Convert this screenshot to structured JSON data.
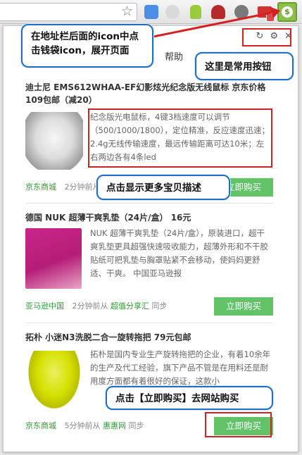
{
  "toolbar": {
    "icons": [
      "star-icon",
      "extension-blue-icon",
      "extension-gray-icon",
      "android-icon",
      "extension-red-icon",
      "extension-gray-round-icon",
      "gmail-icon",
      "wallet-icon"
    ]
  },
  "popup": {
    "help_text": "帮助",
    "tool_icons": [
      "↻",
      "⚙",
      "✕"
    ]
  },
  "callouts": {
    "wallet_hint": "在地址栏后面的icon中点击钱袋icon，展开页面",
    "tools_hint": "这里是常用按钮",
    "desc_hint": "点击显示更多宝贝描述",
    "buy_hint": "点击【立即购买】去网站购买"
  },
  "items": [
    {
      "title": "迪士尼 EMS612WHAA-EF幻影炫光纪念版无线鼠标 京东价格 109包邮（减20）",
      "desc": "纪念版光电鼠标，4键3档速度可以调节（500/1000/1800），定位精准，反应速度迅速；2.4g无线传输速度，最远传输距离可达10米；左右两边各有4条led",
      "source": "京东商城",
      "time": "2分钟前从",
      "buy_label": "立即购买"
    },
    {
      "title": "德国 NUK 超薄干爽乳垫（24片/盒） 16元",
      "desc": "NUK 超薄干爽乳垫（24片/盒），原装进口，超干爽乳垫更具超强快速吸收能力，超薄外形和不干胶贴纸可把乳垫与胸罩贴紧不会移动，使妈妈更舒适、干爽。 中国亚马逊报",
      "source": "亚马逊中国",
      "time": "2分钟前从",
      "from_site": "超值分享汇",
      "sync": "同步",
      "buy_label": "立即购买"
    },
    {
      "title": "拓朴 小迷N3洗脱二合一旋转拖把 79元包邮",
      "desc": "拓朴是国内专业生产旋转拖把的企业，有着10余年的生产及代工经验，旗下产品不管是在用料还是耐用度方面都有着很好的保证，这款小",
      "source": "京东商城",
      "time": "5分钟前从",
      "from_site": "惠惠网",
      "sync": "同步",
      "buy_label": "立即购买"
    }
  ]
}
